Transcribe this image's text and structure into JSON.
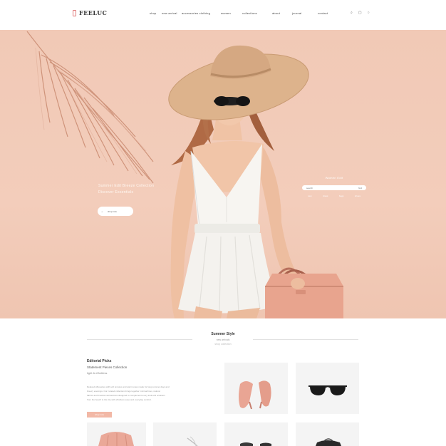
{
  "header": {
    "logo_text": "FEELUC",
    "nav": [
      "shop",
      "new arrival",
      "accessories clothing",
      "women",
      "collections",
      "about",
      "journal",
      "contact"
    ],
    "icons": [
      "search-icon",
      "bag-icon",
      "user-icon"
    ],
    "icon_glyphs": [
      "⌕",
      "▢",
      "○"
    ]
  },
  "hero": {
    "lines": [
      "Summer Edit Breeze Collection",
      "Discover Essentials"
    ],
    "cta_label": "shop now",
    "cta_arrow": "→",
    "side_title": "Women Edit",
    "search_placeholder": "search",
    "search_right": "find",
    "side_links": [
      "new",
      "dress",
      "bags",
      "shoes"
    ],
    "background_color": "#f1c9b6"
  },
  "section": {
    "title": "Summer Style",
    "subtitle": "new arrivals",
    "subtitle2": "shop collection"
  },
  "feature": {
    "title": "Editorial Picks",
    "subtitle": "Statement Pieces Collection",
    "subtitle2": "light & effortless",
    "body": [
      "Relaxed silhouettes with soft textures and warm tones made for long summer days and",
      "breezy evenings. Our curated collection brings together minimal lines, natural",
      "fabrics and timeless accessories designed to complement every look and occasion",
      "from the beach to the city with effortless ease and everyday comfort."
    ],
    "button_label": "shop now"
  },
  "products": [
    "blush-heels",
    "black-sunglasses",
    "pink-skirt",
    "white-sandals",
    "dark-shoes",
    "dark-bag"
  ],
  "colors": {
    "accent": "#f2b8a6",
    "hero_bg": "#f1c9b6",
    "bag": "#e8a48e",
    "dress": "#f7f5f1"
  }
}
